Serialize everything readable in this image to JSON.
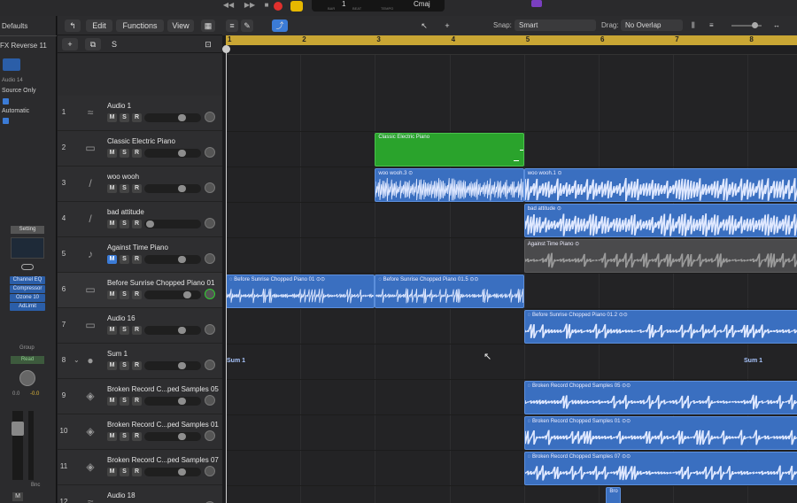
{
  "lcd": {
    "bar_label": "BAR",
    "beat_label": "BEAT",
    "tempo_label": "TEMPO",
    "key": "Cmaj",
    "bar": "1"
  },
  "inspector": {
    "region_label": "Defaults",
    "region_name": "FX Reverse 11",
    "audio_label": "Audio 14",
    "source": "Source Only",
    "automatic": "Automatic",
    "setting": "Setting",
    "plugins": [
      "Channel EQ",
      "Compressor",
      "Ozone 10",
      "AdLimit"
    ],
    "group": "Group",
    "read": "Read",
    "vol_left": "0.0",
    "vol_right": "-0.0",
    "m_btn": "M",
    "bnc": "Bnc"
  },
  "menus": {
    "edit": "Edit",
    "functions": "Functions",
    "view": "View"
  },
  "controls": {
    "snap_label": "Snap:",
    "snap_value": "Smart",
    "drag_label": "Drag:",
    "drag_value": "No Overlap"
  },
  "header_buttons": {
    "add": "+",
    "duplicate": "⧉",
    "s": "S"
  },
  "ruler": [
    "1",
    "2",
    "3",
    "4",
    "5",
    "6",
    "7",
    "8"
  ],
  "tracks": [
    {
      "num": "1",
      "name": "Audio 1",
      "m": "M",
      "s": "S",
      "r": "R",
      "icon": "waveform-icon"
    },
    {
      "num": "2",
      "name": "Classic Electric Piano",
      "m": "M",
      "s": "S",
      "r": "R",
      "icon": "keyboard-icon"
    },
    {
      "num": "3",
      "name": "woo wooh",
      "m": "M",
      "s": "S",
      "r": "R",
      "icon": "microphone-icon"
    },
    {
      "num": "4",
      "name": "bad attitude",
      "m": "M",
      "s": "S",
      "r": "R",
      "icon": "microphone-icon"
    },
    {
      "num": "5",
      "name": "Against Time Piano",
      "m": "M",
      "s": "S",
      "r": "R",
      "icon": "piano-icon"
    },
    {
      "num": "6",
      "name": "Before Sunrise Chopped Piano 01",
      "m": "M",
      "s": "S",
      "r": "R",
      "icon": "keyboard-icon"
    },
    {
      "num": "7",
      "name": "Audio 16",
      "m": "M",
      "s": "S",
      "r": "R",
      "icon": "keyboard-icon"
    },
    {
      "num": "8",
      "name": "Sum 1",
      "m": "M",
      "s": "S",
      "r": "R",
      "icon": "summing-icon"
    },
    {
      "num": "9",
      "name": "Broken Record C...ped Samples 05",
      "m": "M",
      "s": "S",
      "r": "R",
      "icon": "speaker-icon"
    },
    {
      "num": "10",
      "name": "Broken Record C...ped Samples 01",
      "m": "M",
      "s": "S",
      "r": "R",
      "icon": "speaker-icon"
    },
    {
      "num": "11",
      "name": "Broken Record C...ped Samples 07",
      "m": "M",
      "s": "S",
      "r": "R",
      "icon": "speaker-icon"
    },
    {
      "num": "12",
      "name": "Audio 18",
      "m": "M",
      "s": "S",
      "r": "R",
      "icon": "waveform-icon"
    }
  ],
  "regions": [
    {
      "lane": 1,
      "type": "midi",
      "start_bar": 3.0,
      "end_bar": 5.0,
      "name": "Classic Electric Piano"
    },
    {
      "lane": 2,
      "type": "audio",
      "start_bar": 3.0,
      "end_bar": 5.0,
      "name": "woo wooh.3 ⊙"
    },
    {
      "lane": 2,
      "type": "audio",
      "start_bar": 5.0,
      "end_bar": 9.0,
      "name": "woo wooh.1 ⊙"
    },
    {
      "lane": 3,
      "type": "audio",
      "start_bar": 5.0,
      "end_bar": 9.0,
      "name": "bad attitude ⊙"
    },
    {
      "lane": 4,
      "type": "audio gray",
      "start_bar": 5.0,
      "end_bar": 9.0,
      "name": "Against Time Piano ⊙"
    },
    {
      "lane": 5,
      "type": "audio",
      "start_bar": 1.0,
      "end_bar": 3.0,
      "name": "◌ Before Sunrise Chopped Piano 01 ⊙⊙"
    },
    {
      "lane": 5,
      "type": "audio",
      "start_bar": 3.0,
      "end_bar": 5.0,
      "name": "◌ Before Sunrise Chopped Piano 01.5 ⊙⊙"
    },
    {
      "lane": 6,
      "type": "audio",
      "start_bar": 5.0,
      "end_bar": 9.0,
      "name": "◌ Before Sunrise Chopped Piano 01.2 ⊙⊙"
    },
    {
      "lane": 8,
      "type": "audio",
      "start_bar": 5.0,
      "end_bar": 9.0,
      "name": "◌ Broken Record Chopped Samples 05 ⊙⊙"
    },
    {
      "lane": 9,
      "type": "audio",
      "start_bar": 5.0,
      "end_bar": 9.0,
      "name": "◌ Broken Record Chopped Samples 01 ⊙⊙"
    },
    {
      "lane": 10,
      "type": "audio",
      "start_bar": 5.0,
      "end_bar": 9.0,
      "name": "◌ Broken Record Chopped Samples 07 ⊙⊙"
    },
    {
      "lane": 11,
      "type": "audio",
      "start_bar": 6.1,
      "end_bar": 6.3,
      "name": "Bro"
    }
  ],
  "sum_labels": {
    "left": "Sum 1",
    "right": "Sum 1"
  }
}
